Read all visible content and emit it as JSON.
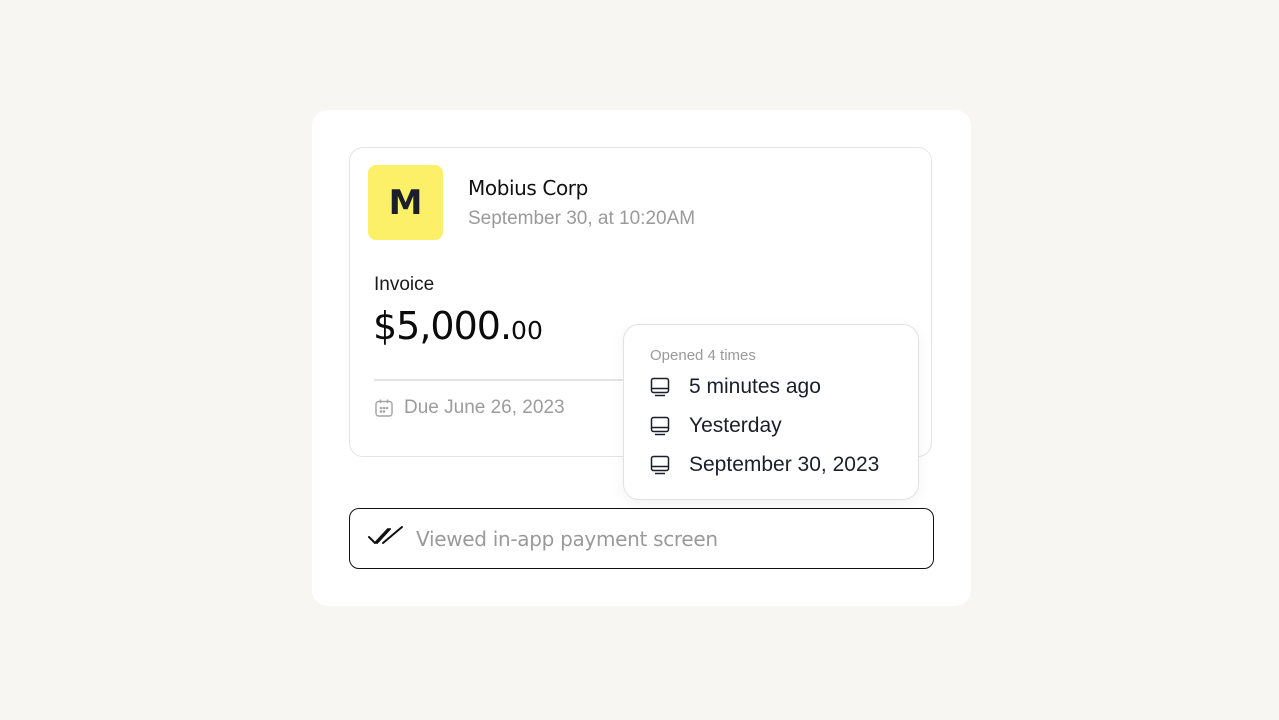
{
  "invoice": {
    "avatar_letter": "M",
    "company_name": "Mobius Corp",
    "date_time": "September 30, at 10:20AM",
    "label": "Invoice",
    "amount_whole": "$5,000.",
    "amount_cents": "00",
    "due": "Due June 26, 2023"
  },
  "popover": {
    "title": "Opened 4 times",
    "items": [
      {
        "label": "5 minutes ago",
        "icon": "monitor-icon"
      },
      {
        "label": "Yesterday",
        "icon": "monitor-icon"
      },
      {
        "label": "September 30, 2023",
        "icon": "monitor-icon"
      }
    ]
  },
  "status": {
    "text": "Viewed in-app payment screen",
    "icon": "double-check-icon"
  },
  "colors": {
    "background": "#f7f6f2",
    "avatar": "#fcf069",
    "muted_text": "#9a9a9a",
    "dark_text": "#1c1f2a"
  }
}
